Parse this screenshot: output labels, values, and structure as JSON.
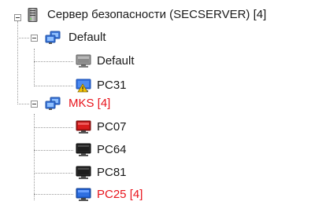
{
  "tree": {
    "server": {
      "label": "Сервер безопасности (SECSERVER) [4]",
      "icon": "server-tower-icon"
    },
    "groups": [
      {
        "label": "Default",
        "icon": "computer-group-icon",
        "status_color": "#1a1a1a",
        "expanded": true,
        "computers": [
          {
            "label": "Default",
            "icon": "computer-gray-icon",
            "screen_color": "#8a8a8a",
            "warning": false,
            "status_color": "#1a1a1a"
          },
          {
            "label": "PC31",
            "icon": "computer-warning-icon",
            "screen_color": "#2f6fe0",
            "warning": true,
            "status_color": "#1a1a1a"
          }
        ]
      },
      {
        "label": "MKS [4]",
        "icon": "computer-group-icon",
        "status_color": "#e8141c",
        "expanded": true,
        "computers": [
          {
            "label": "PC07",
            "icon": "computer-red-icon",
            "screen_color": "#d81c1c",
            "warning": false,
            "status_color": "#1a1a1a"
          },
          {
            "label": "PC64",
            "icon": "computer-black-icon",
            "screen_color": "#1e1e1e",
            "warning": false,
            "status_color": "#1a1a1a"
          },
          {
            "label": "PC81",
            "icon": "computer-black-icon",
            "screen_color": "#1e1e1e",
            "warning": false,
            "status_color": "#1a1a1a"
          },
          {
            "label": "PC25 [4]",
            "icon": "computer-blue-icon",
            "screen_color": "#2f6fe0",
            "warning": false,
            "status_color": "#e8141c"
          }
        ]
      }
    ]
  }
}
